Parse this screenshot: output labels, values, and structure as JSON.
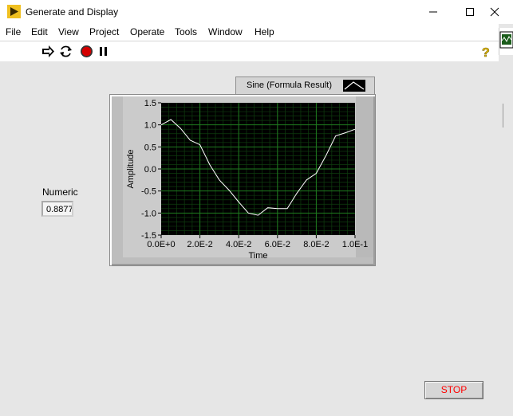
{
  "window": {
    "title": "Generate and Display",
    "minimize_icon": "minimize-icon",
    "maximize_icon": "maximize-icon",
    "close_icon": "close-icon"
  },
  "menu": [
    "File",
    "Edit",
    "View",
    "Project",
    "Operate",
    "Tools",
    "Window",
    "Help"
  ],
  "toolbar": {
    "icons": [
      "run-arrow-icon",
      "run-continuously-icon",
      "abort-execution-icon",
      "pause-icon",
      "context-help-icon"
    ]
  },
  "numeric": {
    "label": "Numeric",
    "value": "0.8877"
  },
  "plot_legend": {
    "name": "Sine (Formula Result)"
  },
  "chart_data": {
    "type": "line",
    "title": "",
    "xlabel": "Time",
    "ylabel": "Amplitude",
    "xlim": [
      0,
      0.1
    ],
    "ylim": [
      -1.5,
      1.5
    ],
    "x_ticks": [
      "0.0E+0",
      "2.0E-2",
      "4.0E-2",
      "6.0E-2",
      "8.0E-2",
      "1.0E-1"
    ],
    "y_ticks": [
      "1.5",
      "1.0",
      "0.5",
      "0.0",
      "-0.5",
      "-1.0",
      "-1.5"
    ],
    "grid": true,
    "colors": {
      "plot_background": "#000000",
      "grid": "#1f7a1f",
      "trace": "#ffffff"
    },
    "series": [
      {
        "name": "Sine (Formula Result)",
        "x": [
          0,
          0.005,
          0.01,
          0.015,
          0.02,
          0.025,
          0.03,
          0.035,
          0.04,
          0.045,
          0.05,
          0.055,
          0.06,
          0.065,
          0.07,
          0.075,
          0.08,
          0.085,
          0.09,
          0.095,
          0.1
        ],
        "y": [
          1.0,
          1.12,
          0.92,
          0.65,
          0.55,
          0.1,
          -0.25,
          -0.48,
          -0.75,
          -1.0,
          -1.05,
          -0.88,
          -0.9,
          -0.9,
          -0.55,
          -0.25,
          -0.1,
          0.3,
          0.75,
          0.82,
          0.9
        ]
      }
    ]
  },
  "stop_button": {
    "label": "STOP"
  }
}
